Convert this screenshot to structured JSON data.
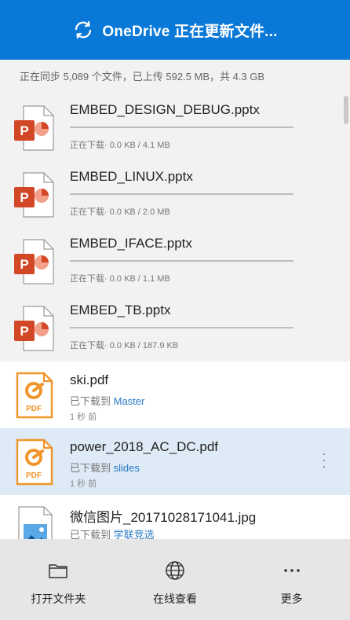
{
  "header": {
    "title": "OneDrive 正在更新文件...",
    "sync_icon": "sync-icon",
    "color": "#0a78d7"
  },
  "summary": {
    "text": "正在同步 5,089 个文件，已上传 592.5 MB，共 4.3 GB"
  },
  "downloading": [
    {
      "name": "EMBED_DESIGN_DEBUG.pptx",
      "status": "正在下载· 0.0 KB / 4.1 MB",
      "icon": "powerpoint-file-icon"
    },
    {
      "name": "EMBED_LINUX.pptx",
      "status": "正在下载· 0.0 KB / 2.0 MB",
      "icon": "powerpoint-file-icon"
    },
    {
      "name": "EMBED_IFACE.pptx",
      "status": "正在下载· 0.0 KB / 1.1 MB",
      "icon": "powerpoint-file-icon"
    },
    {
      "name": "EMBED_TB.pptx",
      "status": "正在下载· 0.0 KB / 187.9 KB",
      "icon": "powerpoint-file-icon"
    }
  ],
  "downloaded": [
    {
      "name": "ski.pdf",
      "prefix": "已下载到 ",
      "folder": "Master",
      "time": "1 秒 前",
      "icon": "pdf-file-icon",
      "selected": false
    },
    {
      "name": "power_2018_AC_DC.pdf",
      "prefix": "已下载到 ",
      "folder": "slides",
      "time": "1 秒 前",
      "icon": "pdf-file-icon",
      "selected": true
    },
    {
      "name": "微信图片_20171028171041.jpg",
      "prefix": "已下载到 ",
      "folder": "学联竞选",
      "time": "",
      "icon": "image-file-icon",
      "selected": false
    }
  ],
  "toolbar": {
    "open_folder": "打开文件夹",
    "view_online": "在线查看",
    "more": "更多"
  }
}
